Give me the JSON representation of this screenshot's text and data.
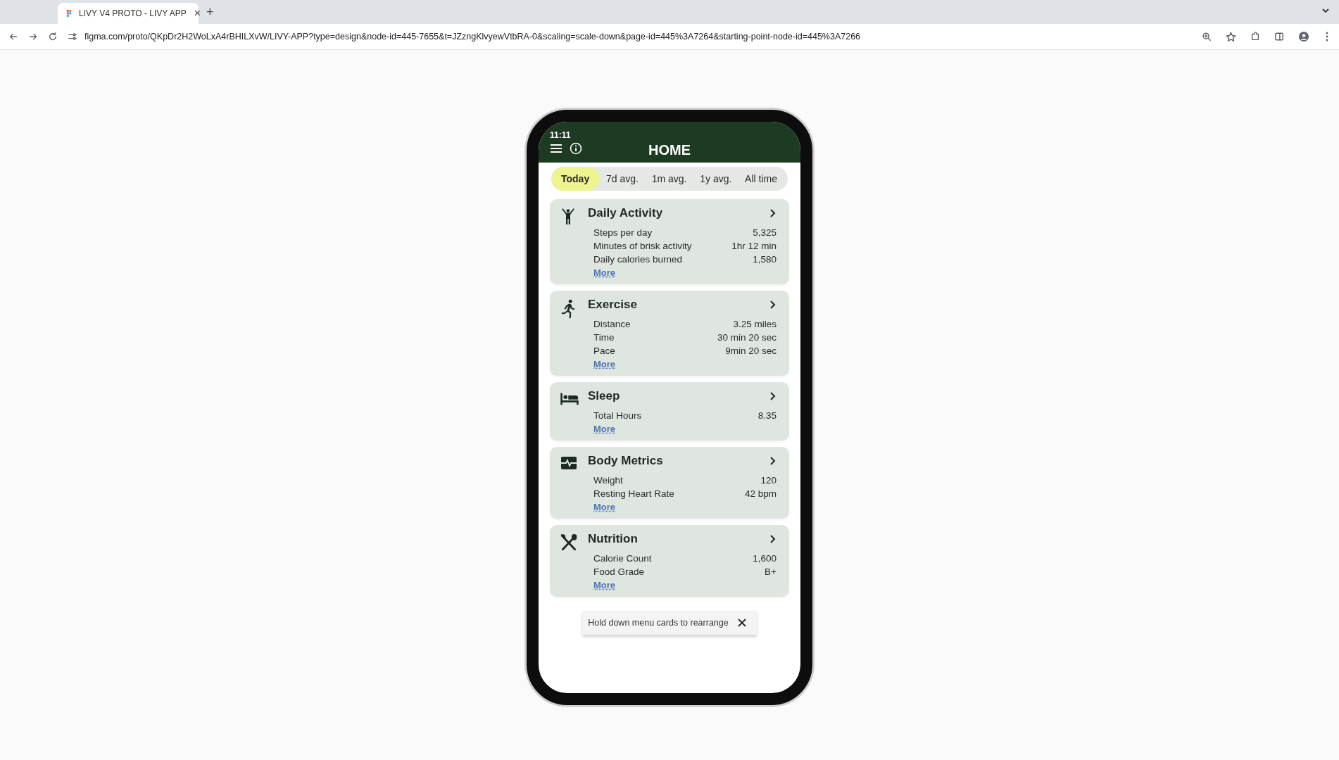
{
  "browser": {
    "tab_title": "LIVY V4 PROTO - LIVY APP",
    "tab_close": "×",
    "new_tab": "+",
    "url": "figma.com/proto/QKpDr2H2WoLxA4rBHILXvW/LIVY-APP?type=design&node-id=445-7655&t=JZzngKlvyewVtbRA-0&scaling=scale-down&page-id=445%3A7264&starting-point-node-id=445%3A7266"
  },
  "phone": {
    "time": "11:11",
    "title": "HOME"
  },
  "tabs": [
    {
      "label": "Today",
      "selected": true
    },
    {
      "label": "7d avg.",
      "selected": false
    },
    {
      "label": "1m avg.",
      "selected": false
    },
    {
      "label": "1y avg.",
      "selected": false
    },
    {
      "label": "All time",
      "selected": false
    }
  ],
  "cards": [
    {
      "kind": "activity",
      "title": "Daily Activity",
      "rows": [
        [
          "Steps per day",
          "5,325"
        ],
        [
          "Minutes of brisk activity",
          "1hr 12 min"
        ],
        [
          "Daily calories burned",
          "1,580"
        ]
      ],
      "link": "More"
    },
    {
      "kind": "exercise",
      "title": "Exercise",
      "rows": [
        [
          "Distance",
          "3.25 miles"
        ],
        [
          "Time",
          "30 min 20 sec"
        ],
        [
          "Pace",
          "9min 20 sec"
        ]
      ],
      "link": "More"
    },
    {
      "kind": "sleep",
      "title": "Sleep",
      "rows": [
        [
          "Total Hours",
          "8.35"
        ]
      ],
      "link": "More"
    },
    {
      "kind": "body",
      "title": "Body Metrics",
      "rows": [
        [
          "Weight",
          "120"
        ],
        [
          "Resting Heart Rate",
          "42 bpm"
        ]
      ],
      "link": "More"
    },
    {
      "kind": "nutrition",
      "title": "Nutrition",
      "rows": [
        [
          "Calorie Count",
          "1,600"
        ],
        [
          "Food Grade",
          "B+"
        ]
      ],
      "link": "More"
    }
  ],
  "toast": {
    "message": "Hold down menu cards to rearrange"
  }
}
